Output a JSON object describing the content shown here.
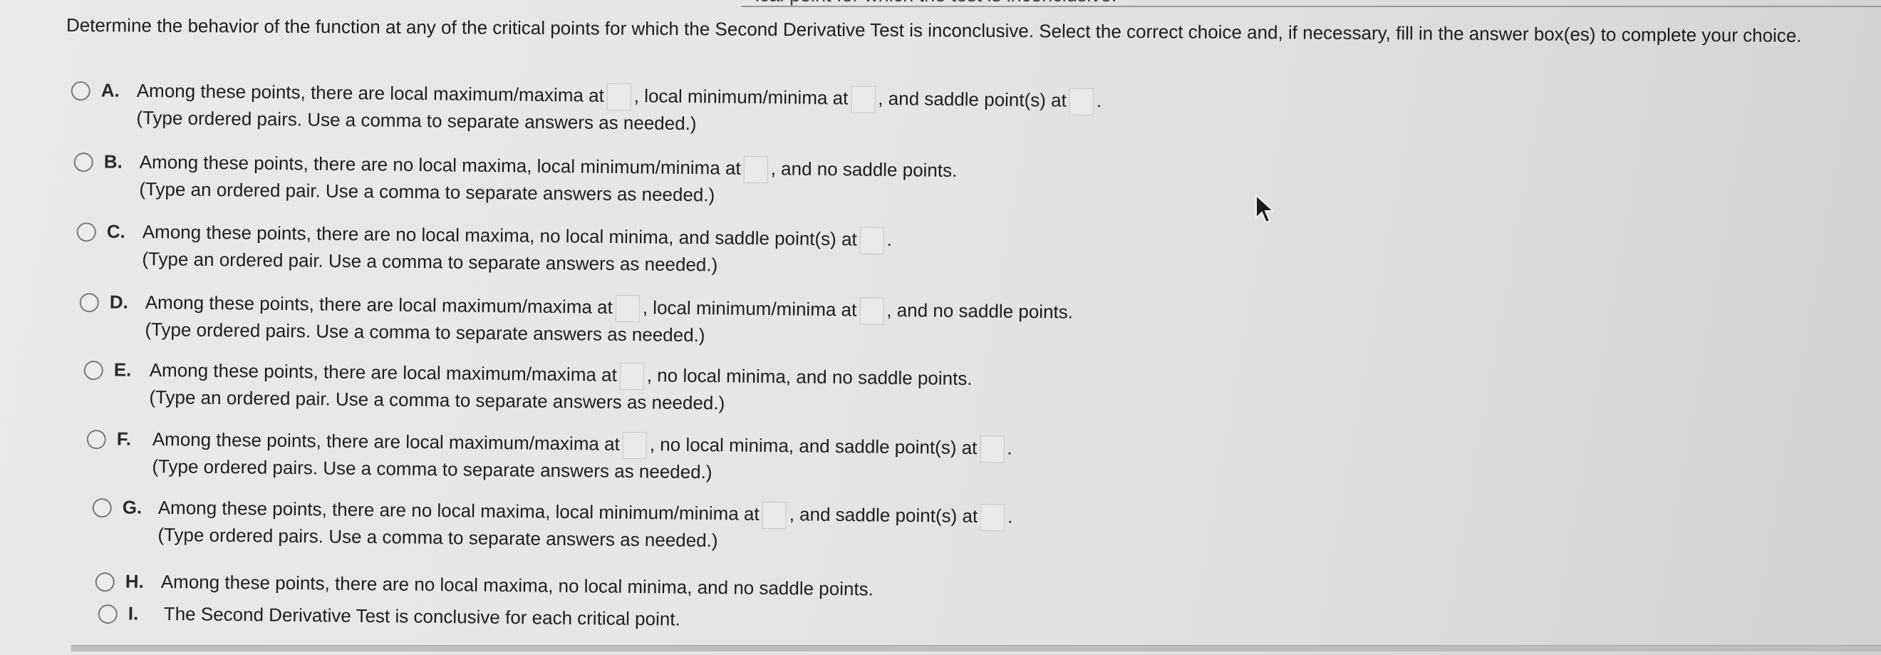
{
  "header": {
    "cutoff_text": "ical point for which the test is inconclusive."
  },
  "question": "Determine the behavior of the function at any of the critical points for which the Second Derivative Test is inconclusive. Select the correct choice and, if necessary, fill in the answer box(es) to complete your choice.",
  "choices": [
    {
      "letter": "A.",
      "line1": [
        "Among these points, there are local maximum/maxima at",
        ", local minimum/minima at",
        ", and saddle point(s) at",
        "."
      ],
      "hint": "(Type ordered pairs. Use a comma to separate answers as needed.)"
    },
    {
      "letter": "B.",
      "line1": [
        "Among these points, there are no local maxima, local minimum/minima at",
        ", and no saddle points."
      ],
      "hint": "(Type an ordered pair. Use a comma to separate answers as needed.)"
    },
    {
      "letter": "C.",
      "line1": [
        "Among these points, there are no local maxima, no local minima, and saddle point(s) at",
        "."
      ],
      "hint": "(Type an ordered pair. Use a comma to separate answers as needed.)"
    },
    {
      "letter": "D.",
      "line1": [
        "Among these points, there are local maximum/maxima at",
        ", local minimum/minima at",
        ", and no saddle points."
      ],
      "hint": "(Type ordered pairs. Use a comma to separate answers as needed.)"
    },
    {
      "letter": "E.",
      "line1": [
        "Among these points, there are local maximum/maxima at",
        ", no local minima, and no saddle points."
      ],
      "hint": "(Type an ordered pair. Use a comma to separate answers as needed.)"
    },
    {
      "letter": "F.",
      "line1": [
        "Among these points, there are local maximum/maxima at",
        ", no local minima, and saddle point(s) at",
        "."
      ],
      "hint": "(Type ordered pairs. Use a comma to separate answers as needed.)"
    },
    {
      "letter": "G.",
      "line1": [
        "Among these points, there are no local maxima, local minimum/minima at",
        ", and saddle point(s) at",
        "."
      ],
      "hint": "(Type ordered pairs. Use a comma to separate answers as needed.)"
    },
    {
      "letter": "H.",
      "line1": [
        "Among these points, there are no local maxima, no local minima, and no saddle points."
      ],
      "hint": ""
    },
    {
      "letter": "I.",
      "line1": [
        "The Second Derivative Test is conclusive for each critical point."
      ],
      "hint": ""
    }
  ],
  "icons": {
    "cursor": "mouse-pointer-icon"
  },
  "colors": {
    "background": "#e6e6e4",
    "text": "#1e1e1e",
    "radio_border": "#7a7a7a",
    "answer_box_border": "#c9c9c7"
  }
}
